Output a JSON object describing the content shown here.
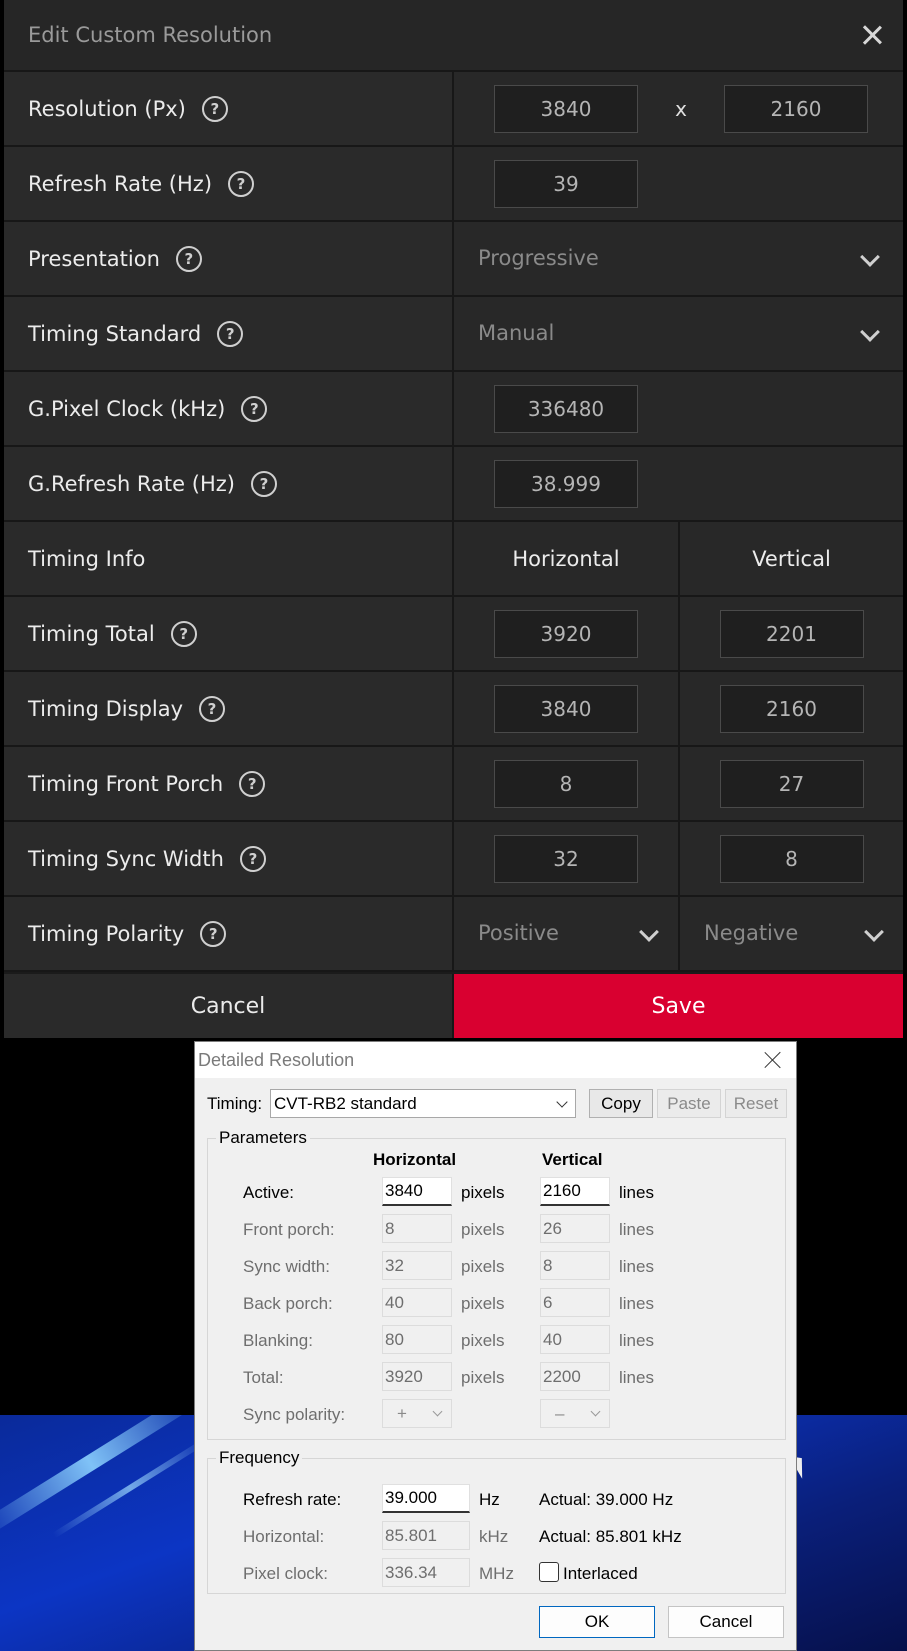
{
  "amd": {
    "title": "Edit Custom Resolution",
    "help_glyph": "?",
    "resolution": {
      "label": "Resolution (Px)",
      "width": "3840",
      "separator": "x",
      "height": "2160"
    },
    "refresh_rate": {
      "label": "Refresh Rate (Hz)",
      "value": "39"
    },
    "presentation": {
      "label": "Presentation",
      "value": "Progressive"
    },
    "timing_standard": {
      "label": "Timing Standard",
      "value": "Manual"
    },
    "pixel_clock": {
      "label": "G.Pixel Clock (kHz)",
      "value": "336480"
    },
    "g_refresh": {
      "label": "G.Refresh Rate (Hz)",
      "value": "38.999"
    },
    "timing_info": {
      "label": "Timing Info",
      "horizontal": "Horizontal",
      "vertical": "Vertical"
    },
    "timing_total": {
      "label": "Timing Total",
      "h": "3920",
      "v": "2201"
    },
    "timing_display": {
      "label": "Timing Display",
      "h": "3840",
      "v": "2160"
    },
    "front_porch": {
      "label": "Timing Front Porch",
      "h": "8",
      "v": "27"
    },
    "sync_width": {
      "label": "Timing Sync Width",
      "h": "32",
      "v": "8"
    },
    "polarity": {
      "label": "Timing Polarity",
      "h": "Positive",
      "v": "Negative"
    },
    "cancel": "Cancel",
    "save": "Save",
    "accent": "#d90030"
  },
  "cru": {
    "title": "Detailed Resolution",
    "timing_label": "Timing:",
    "timing_value": "CVT-RB2 standard",
    "copy": "Copy",
    "paste": "Paste",
    "reset": "Reset",
    "parameters": "Parameters",
    "horizontal": "Horizontal",
    "vertical": "Vertical",
    "rows": [
      {
        "label": "Active:",
        "h": "3840",
        "hunit": "pixels",
        "v": "2160",
        "vunit": "lines"
      },
      {
        "label": "Front porch:",
        "h": "8",
        "hunit": "pixels",
        "v": "26",
        "vunit": "lines"
      },
      {
        "label": "Sync width:",
        "h": "32",
        "hunit": "pixels",
        "v": "8",
        "vunit": "lines"
      },
      {
        "label": "Back porch:",
        "h": "40",
        "hunit": "pixels",
        "v": "6",
        "vunit": "lines"
      },
      {
        "label": "Blanking:",
        "h": "80",
        "hunit": "pixels",
        "v": "40",
        "vunit": "lines"
      },
      {
        "label": "Total:",
        "h": "3920",
        "hunit": "pixels",
        "v": "2200",
        "vunit": "lines"
      }
    ],
    "sync_polarity": {
      "label": "Sync polarity:",
      "h": "+",
      "v": "–"
    },
    "frequency": "Frequency",
    "refresh": {
      "label": "Refresh rate:",
      "value": "39.000",
      "unit": "Hz",
      "actual": "Actual: 39.000 Hz"
    },
    "horiz": {
      "label": "Horizontal:",
      "value": "85.801",
      "unit": "kHz",
      "actual": "Actual: 85.801 kHz"
    },
    "pixclk": {
      "label": "Pixel clock:",
      "value": "336.34",
      "unit": "MHz"
    },
    "interlaced": "Interlaced",
    "ok": "OK",
    "cancel": "Cancel"
  }
}
